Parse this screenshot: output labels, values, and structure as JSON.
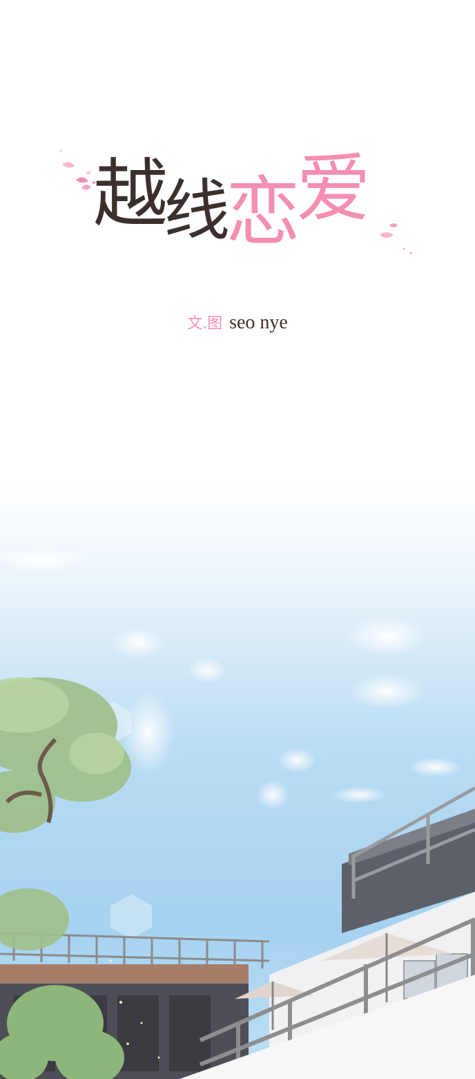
{
  "title": {
    "chars": [
      "越",
      "线",
      "恋",
      "爱"
    ]
  },
  "credit": {
    "label": "文.图",
    "author": "seo nye"
  },
  "colors": {
    "brown": "#3b302c",
    "pink": "#f48fb1",
    "sky": "#a9d4f0"
  },
  "illustration": {
    "description_icon": "sky-building-tree-scene"
  }
}
